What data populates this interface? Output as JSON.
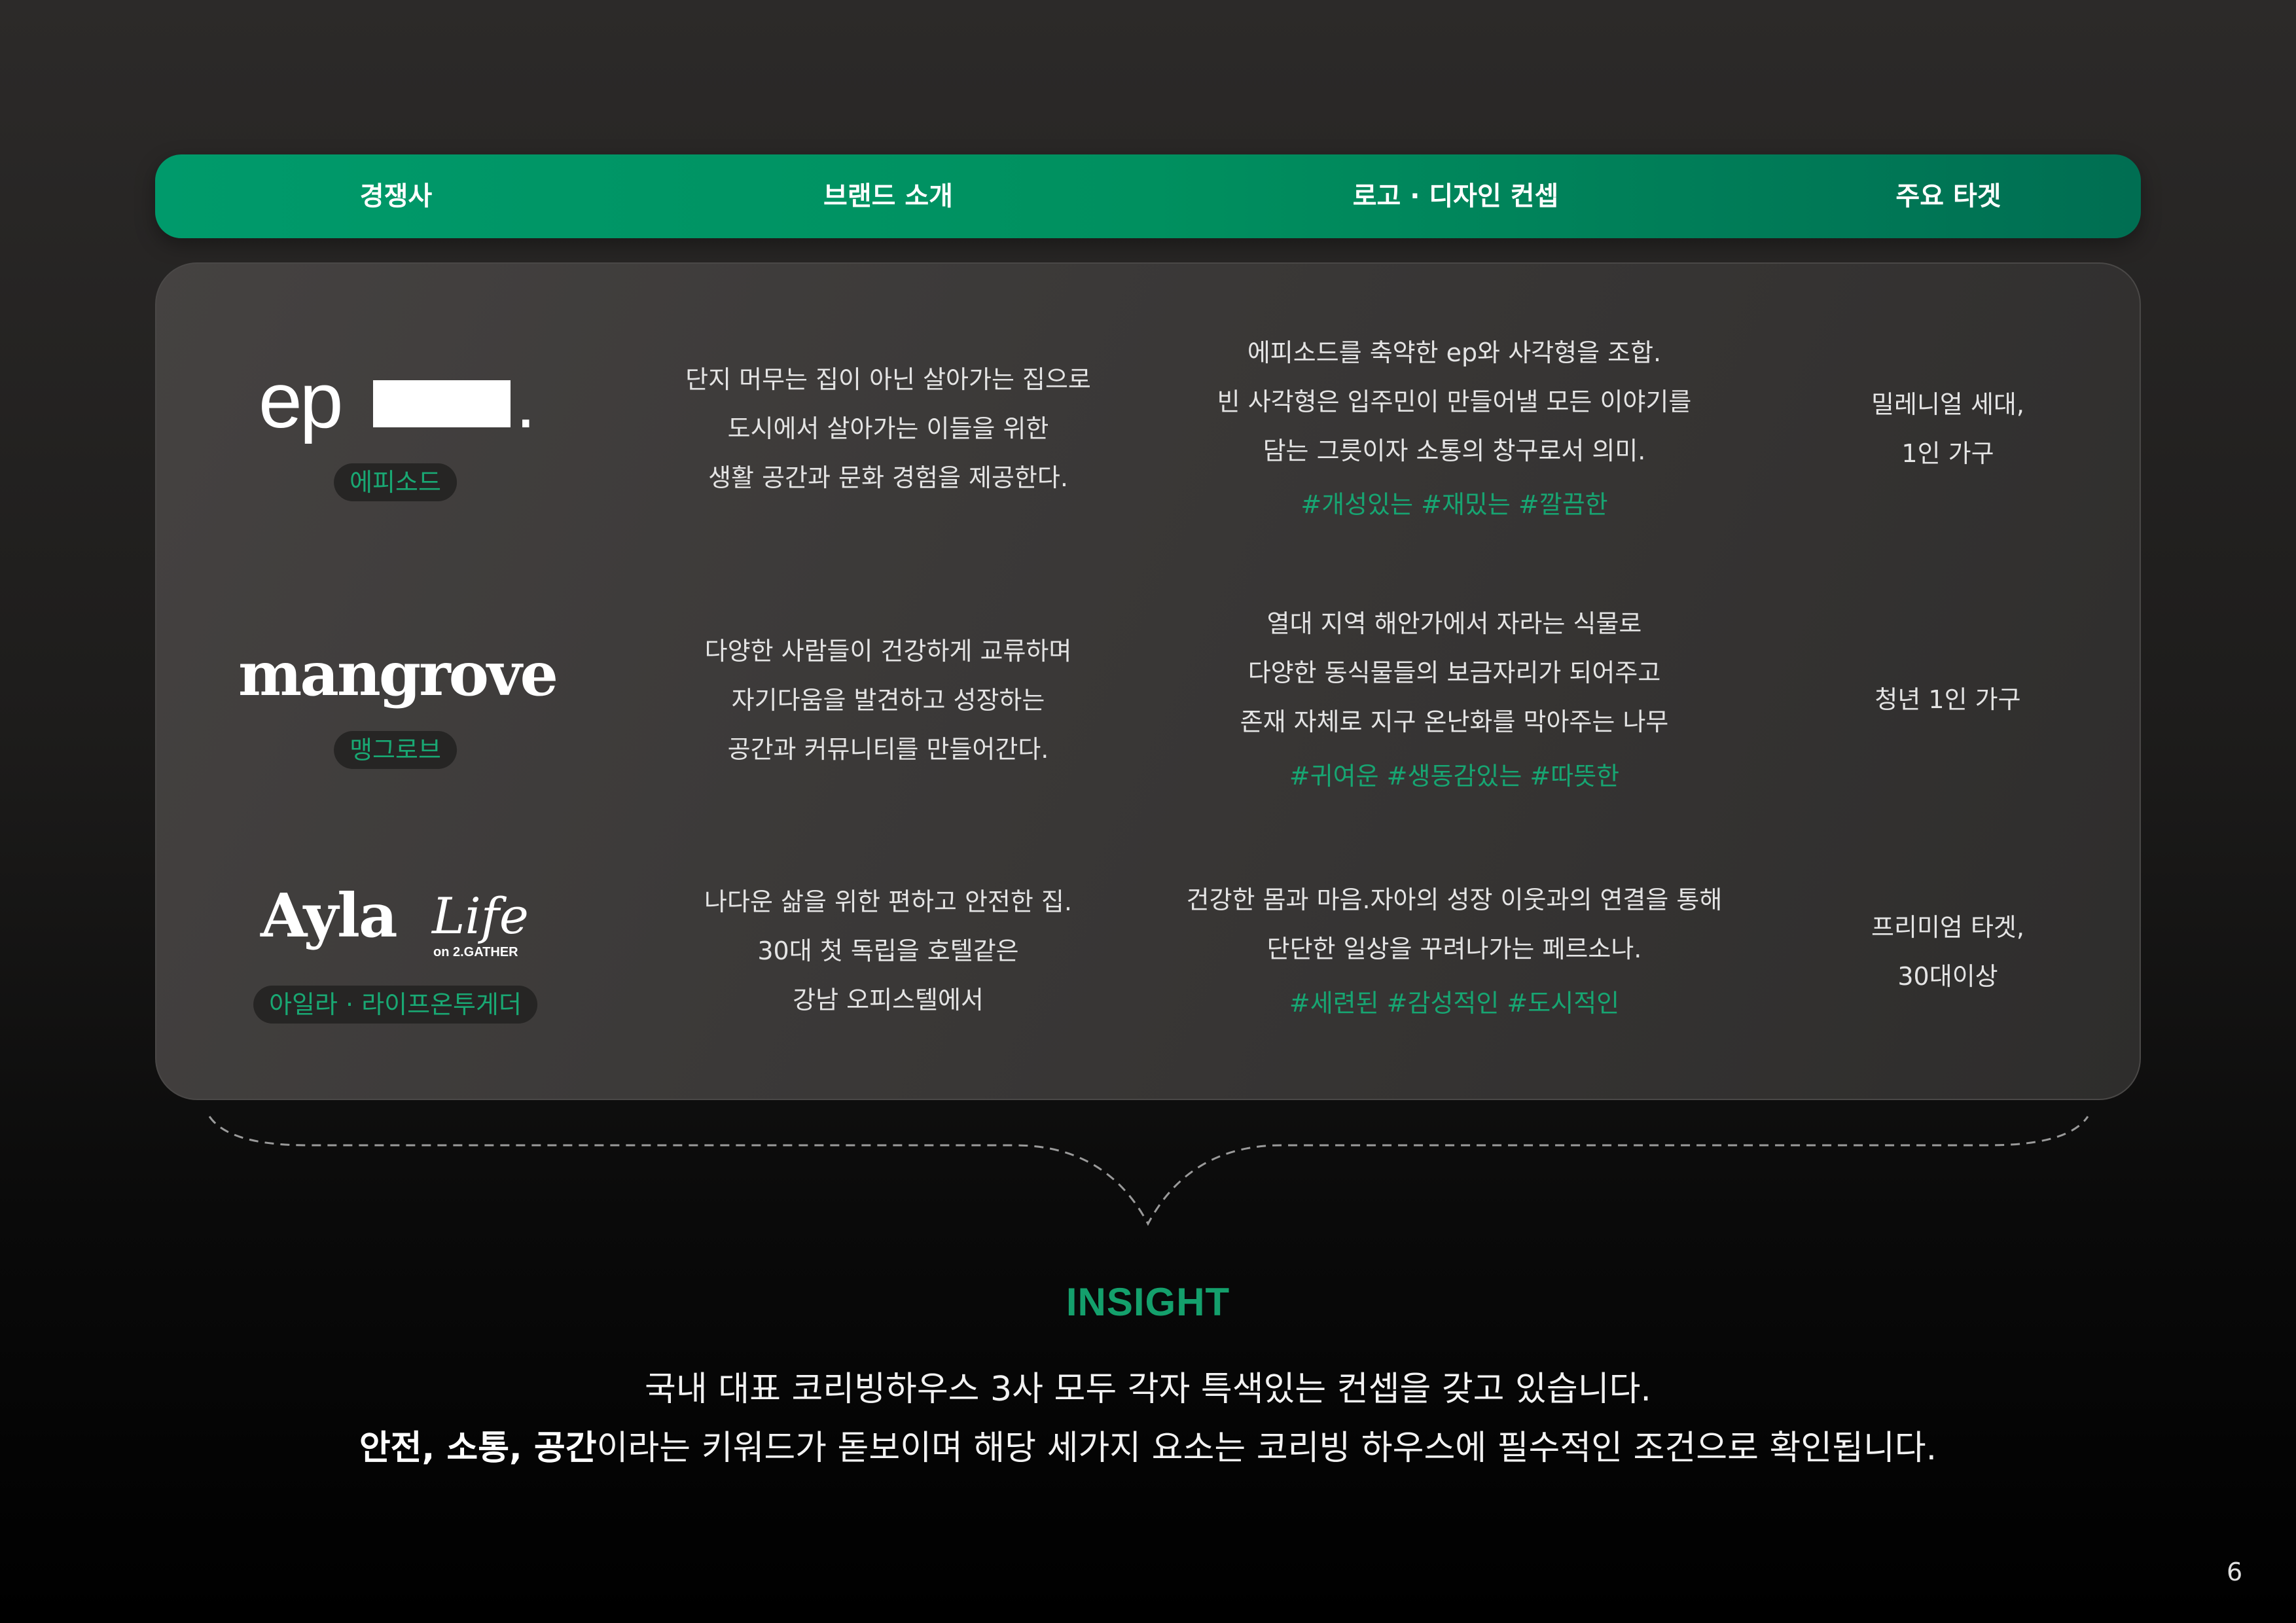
{
  "header": {
    "competitor": "경쟁사",
    "brand_intro": "브랜드 소개",
    "logo_concept": "로고 · 디자인 컨셉",
    "target": "주요 타겟"
  },
  "rows": [
    {
      "logo_text": "ep",
      "logo_punct": ".",
      "name": "에피소드",
      "intro": [
        "단지 머무는 집이 아닌 살아가는 집으로",
        "도시에서 살아가는 이들을 위한",
        "생활 공간과 문화 경험을 제공한다."
      ],
      "concept": [
        "에피소드를 축약한 ep와 사각형을 조합.",
        "빈 사각형은 입주민이 만들어낼 모든 이야기를",
        "담는 그릇이자 소통의 창구로서 의미."
      ],
      "tags": "#개성있는 #재밌는 #깔끔한",
      "target": [
        "밀레니얼 세대,",
        "1인 가구"
      ]
    },
    {
      "logo_text": "mangrove",
      "name": "맹그로브",
      "intro": [
        "다양한 사람들이 건강하게 교류하며",
        "자기다움을 발견하고 성장하는",
        "공간과 커뮤니티를 만들어간다."
      ],
      "concept": [
        "열대 지역 해안가에서 자라는 식물로",
        "다양한 동식물들의 보금자리가 되어주고",
        "존재 자체로 지구 온난화를 막아주는 나무"
      ],
      "tags": "#귀여운 #생동감있는 #따뜻한",
      "target": [
        "청년 1인 가구"
      ]
    },
    {
      "logo_text": "Ayla",
      "logo_text2": "Life",
      "logo_sub": "on 2.GATHER",
      "name": "아일라 · 라이프온투게더",
      "intro": [
        "나다운 삶을 위한 편하고 안전한 집.",
        "30대 첫 독립을 호텔같은",
        "강남 오피스텔에서"
      ],
      "concept": [
        "건강한 몸과 마음.자아의 성장 이웃과의 연결을 통해",
        "단단한 일상을 꾸려나가는 페르소나."
      ],
      "tags": "#세련된 #감성적인 #도시적인",
      "target": [
        "프리미엄 타겟,",
        "30대이상"
      ]
    }
  ],
  "insight": {
    "title": "INSIGHT",
    "line1": "국내 대표 코리빙하우스 3사 모두 각자 특색있는 컨셉을 갖고 있습니다.",
    "line2_bold": "안전, 소통, 공간",
    "line2_rest": "이라는 키워드가 돋보이며 해당 세가지 요소는 코리빙 하우스에 필수적인 조건으로 확인됩니다."
  },
  "page_number": "6",
  "colors": {
    "accent_green": "#14a06c",
    "header_green": "#009a6b",
    "header_green_dark": "#006e52"
  }
}
